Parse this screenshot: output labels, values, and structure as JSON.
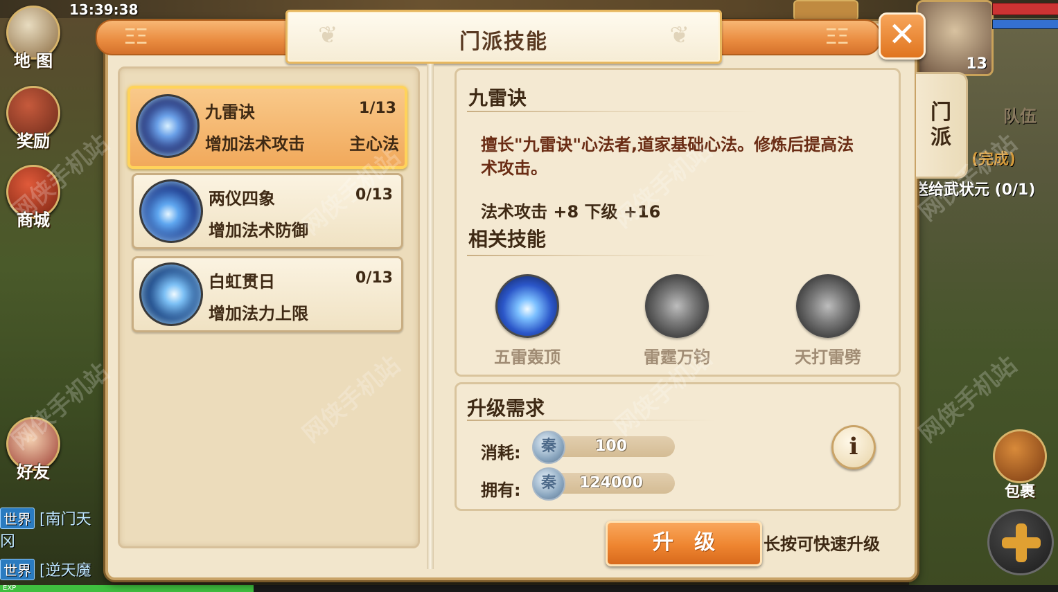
{
  "status": {
    "clock": "13:39:38"
  },
  "hud": {
    "left_buttons": [
      {
        "label": "地 图"
      },
      {
        "label": "奖励"
      },
      {
        "label": "商城"
      },
      {
        "label": "好友"
      }
    ],
    "chat": [
      {
        "channel": "世界",
        "text": "[南门天"
      },
      {
        "channel": "",
        "text": "冈"
      },
      {
        "channel": "世界",
        "text": "[逆天魔"
      }
    ],
    "exp_label": "EXP",
    "exp_fraction": 0.24,
    "team_tab": "队伍",
    "quest_done": "(完成)",
    "quest_text": "送给武状元 (0/1)",
    "player_level": "13",
    "bag_label": "包裹",
    "plus_icon": "plus-icon"
  },
  "panel": {
    "title": "门派技能",
    "close_icon": "close-icon",
    "side_tab": "门\n派",
    "skills": [
      {
        "name": "九雷诀",
        "level": "1/13",
        "desc": "增加法术攻击",
        "tag": "主心法",
        "active": true
      },
      {
        "name": "两仪四象",
        "level": "0/13",
        "desc": "增加法术防御",
        "tag": "",
        "active": false
      },
      {
        "name": "白虹贯日",
        "level": "0/13",
        "desc": "增加法力上限",
        "tag": "",
        "active": false
      }
    ],
    "detail": {
      "name": "九雷诀",
      "description": "擅长\"九雷诀\"心法者,道家基础心法。修炼后提高法术攻击。",
      "stats": "法术攻击 +8  下级 +16",
      "related_title": "相关技能",
      "related": [
        {
          "name": "五雷轰顶",
          "unlocked": true
        },
        {
          "name": "雷霆万钧",
          "unlocked": false
        },
        {
          "name": "天打雷劈",
          "unlocked": false
        }
      ]
    },
    "requirements": {
      "title": "升级需求",
      "cost_label": "消耗:",
      "cost_value": "100",
      "own_label": "拥有:",
      "own_value": "124000",
      "coin_glyph": "秦",
      "info_icon": "info-icon"
    },
    "upgrade_label": "升级",
    "hint": "长按可快速升级"
  },
  "watermark": "网侠手机站",
  "colors": {
    "accent_orange": "#ee8530",
    "panel_bg": "#f2e6cc",
    "text_brown": "#3e2914",
    "desc_red": "#6a2c14",
    "active_border": "#ffd35a"
  }
}
